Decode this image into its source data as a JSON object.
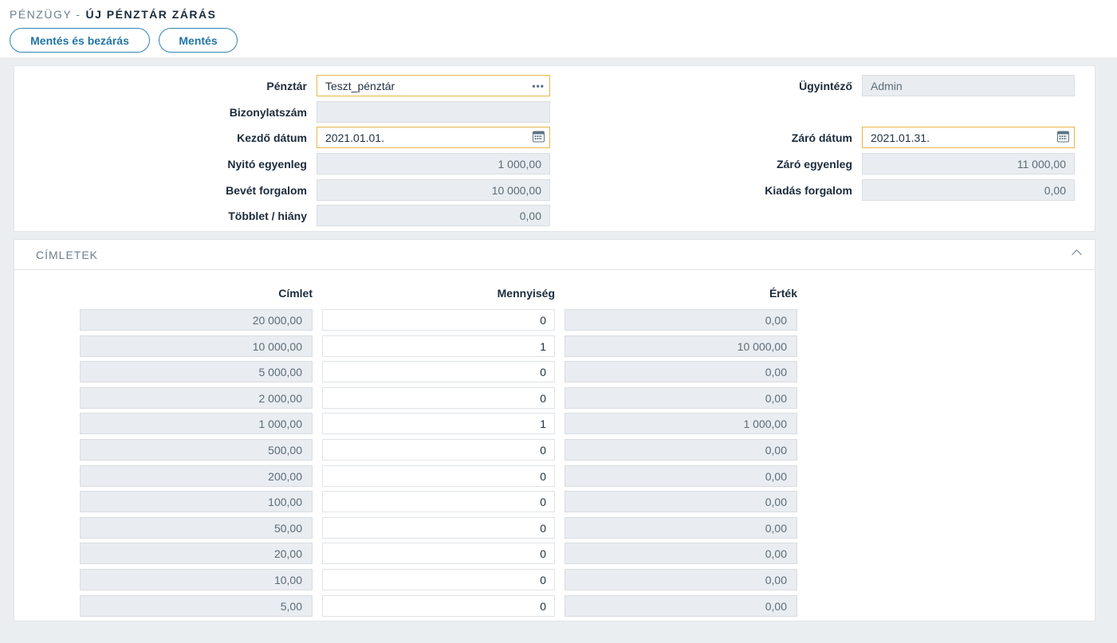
{
  "header": {
    "breadcrumb": "PÉNZÜGY -",
    "title": "ÚJ PÉNZTÁR ZÁRÁS",
    "buttons": {
      "save_close": "Mentés és bezárás",
      "save": "Mentés"
    }
  },
  "form": {
    "penztar": {
      "label": "Pénztár",
      "value": "Teszt_pénztár"
    },
    "bizonylatszam": {
      "label": "Bizonylatszám",
      "value": ""
    },
    "kezdo_datum": {
      "label": "Kezdő dátum",
      "value": "2021.01.01."
    },
    "nyito_egyenleg": {
      "label": "Nyitó egyenleg",
      "value": "1 000,00"
    },
    "bevet_forgalom": {
      "label": "Bevét forgalom",
      "value": "10 000,00"
    },
    "tobblet_hiany": {
      "label": "Többlet / hiány",
      "value": "0,00"
    },
    "ugyintezo": {
      "label": "Ügyintéző",
      "value": "Admin"
    },
    "zaro_datum": {
      "label": "Záró dátum",
      "value": "2021.01.31."
    },
    "zaro_egyenleg": {
      "label": "Záró egyenleg",
      "value": "11 000,00"
    },
    "kiadas_forgalom": {
      "label": "Kiadás forgalom",
      "value": "0,00"
    }
  },
  "cimletek": {
    "title": "CÍMLETEK",
    "columns": {
      "cimlet": "Címlet",
      "mennyiseg": "Mennyiség",
      "ertek": "Érték"
    },
    "rows": [
      {
        "cimlet": "20 000,00",
        "mennyiseg": "0",
        "ertek": "0,00"
      },
      {
        "cimlet": "10 000,00",
        "mennyiseg": "1",
        "ertek": "10 000,00"
      },
      {
        "cimlet": "5 000,00",
        "mennyiseg": "0",
        "ertek": "0,00"
      },
      {
        "cimlet": "2 000,00",
        "mennyiseg": "0",
        "ertek": "0,00"
      },
      {
        "cimlet": "1 000,00",
        "mennyiseg": "1",
        "ertek": "1 000,00"
      },
      {
        "cimlet": "500,00",
        "mennyiseg": "0",
        "ertek": "0,00"
      },
      {
        "cimlet": "200,00",
        "mennyiseg": "0",
        "ertek": "0,00"
      },
      {
        "cimlet": "100,00",
        "mennyiseg": "0",
        "ertek": "0,00"
      },
      {
        "cimlet": "50,00",
        "mennyiseg": "0",
        "ertek": "0,00"
      },
      {
        "cimlet": "20,00",
        "mennyiseg": "0",
        "ertek": "0,00"
      },
      {
        "cimlet": "10,00",
        "mennyiseg": "0",
        "ertek": "0,00"
      },
      {
        "cimlet": "5,00",
        "mennyiseg": "0",
        "ertek": "0,00"
      }
    ]
  },
  "colors": {
    "accent": "#2f84b5",
    "edit_border": "#e8b647",
    "readonly_bg": "#e9edf1"
  },
  "icons": {
    "lookup": "dots-icon",
    "date": "calendar-icon",
    "collapse": "chevron-up-icon"
  }
}
